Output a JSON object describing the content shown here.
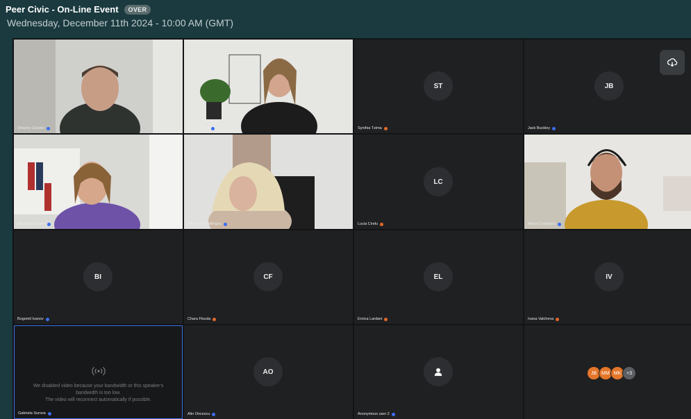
{
  "header": {
    "title": "Peer Civic - On-Line Event",
    "status_badge": "OVER",
    "subtitle": "Wednesday, December 11th 2024 - 10:00 AM (GMT)"
  },
  "participants": [
    {
      "name": "Shaune Crackin",
      "mic_status": "blue"
    },
    {
      "name": "Mary WZ..og",
      "mic_status": "blue"
    },
    {
      "name": "Synthia Tzima",
      "initials": "ST",
      "mic_status": "orange"
    },
    {
      "name": "Jack Buckley",
      "initials": "JB",
      "mic_status": "blue"
    },
    {
      "name": "Madalina Ostafe",
      "mic_status": "blue"
    },
    {
      "name": "Athanasia Dellingou",
      "mic_status": "blue"
    },
    {
      "name": "Lucia Cirelu",
      "initials": "LC",
      "mic_status": "orange"
    },
    {
      "name": "Marco Castanilo",
      "mic_status": "blue"
    },
    {
      "name": "Bogomil Ivanov",
      "initials": "BI",
      "mic_status": "blue"
    },
    {
      "name": "Chara Flouda",
      "initials": "CF",
      "mic_status": "orange"
    },
    {
      "name": "Enrica Lardani",
      "initials": "EL",
      "mic_status": "orange"
    },
    {
      "name": "Ivana Valcheva",
      "initials": "IV",
      "mic_status": "orange"
    },
    {
      "name": "Gabriela Surova",
      "mic_status": "blue"
    },
    {
      "name": "Alin Oncescu",
      "initials": "AO",
      "mic_status": "blue"
    },
    {
      "name": "Anonymous user 2",
      "mic_status": "blue"
    }
  ],
  "bandwidth_notice": {
    "line1": "We disabled video because your bandwidth or this speaker's",
    "line2": "bandwidth is too low.",
    "line3": "The video will reconnect automatically if possible."
  },
  "overflow_avatars": [
    {
      "initials": "JB",
      "color": "#e4762a"
    },
    {
      "initials": "MM",
      "color": "#e4762a"
    },
    {
      "initials": "MK",
      "color": "#e4762a"
    }
  ],
  "overflow_count": "+3",
  "icons": {
    "download": "cloud-download-icon",
    "broadcast": "broadcast-icon",
    "anonymous": "person-icon"
  },
  "colors": {
    "mic_blue": "#3b6ff2",
    "mic_orange": "#e4682a",
    "self_border": "#3c6fe8"
  }
}
